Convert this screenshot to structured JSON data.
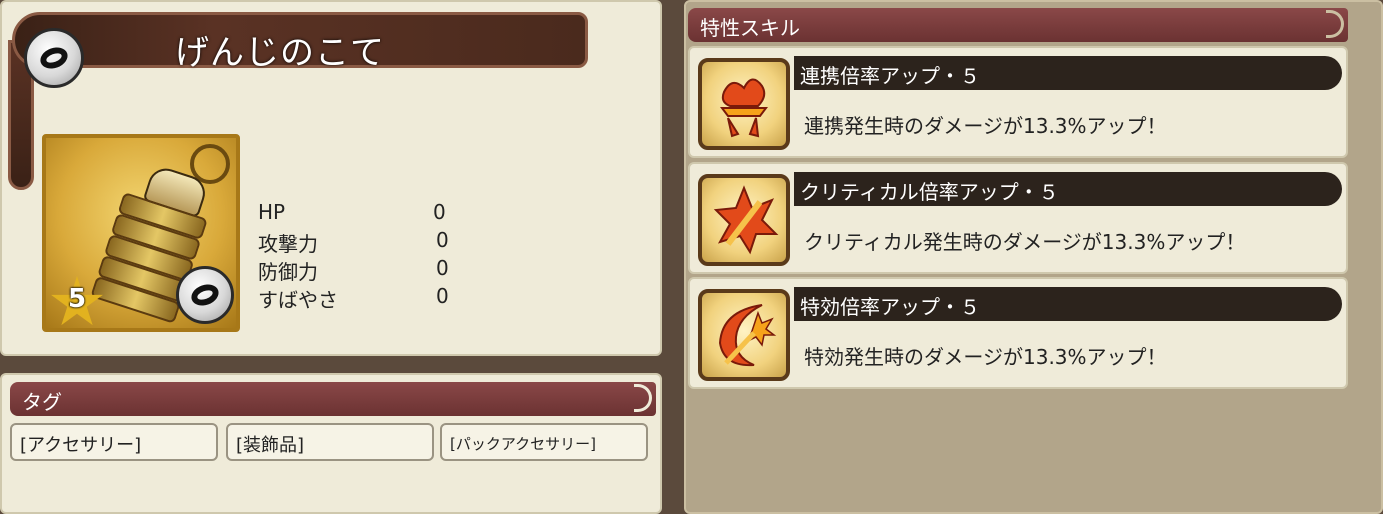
{
  "item": {
    "name": "げんじのこて",
    "rarity": "5"
  },
  "stats": [
    {
      "label": "HP",
      "value": "0"
    },
    {
      "label": "攻撃力",
      "value": "0"
    },
    {
      "label": "防御力",
      "value": "0"
    },
    {
      "label": "すばやさ",
      "value": "0"
    }
  ],
  "tags": {
    "header": "タグ",
    "items": [
      "[アクセサリー]",
      "[装飾品]",
      "[パックアクセサリー]"
    ]
  },
  "skills": {
    "header": "特性スキル",
    "items": [
      {
        "name": "連携倍率アップ・５",
        "desc": "連携発生時のダメージが13.3%アップ！",
        "icon": "combo-boost-icon"
      },
      {
        "name": "クリティカル倍率アップ・５",
        "desc": "クリティカル発生時のダメージが13.3%アップ！",
        "icon": "critical-boost-icon"
      },
      {
        "name": "特効倍率アップ・５",
        "desc": "特効発生時のダメージが13.3%アップ！",
        "icon": "special-effect-boost-icon"
      }
    ]
  },
  "colors": {
    "header_red": "#6b3232",
    "card_gold": "#d9a93a",
    "panel_bg": "#efebd9"
  }
}
